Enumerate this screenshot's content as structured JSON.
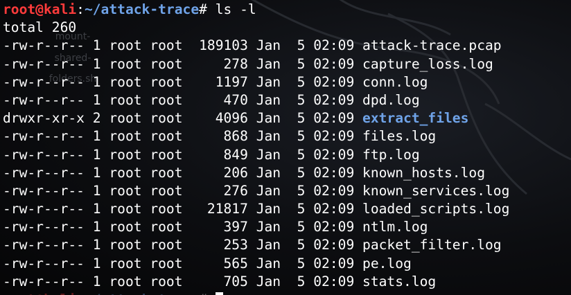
{
  "prompt": {
    "user_host": "root@kali",
    "separator": ":",
    "path": "~/attack-trace",
    "symbol": "# ",
    "command": "ls -l"
  },
  "total_line": "total 260",
  "listing": [
    {
      "perms": "-rw-r--r--",
      "links": "1",
      "owner": "root",
      "group": "root",
      "size": "189103",
      "month": "Jan",
      "day": "5",
      "time": "02:09",
      "name": "attack-trace.pcap",
      "type": "file"
    },
    {
      "perms": "-rw-r--r--",
      "links": "1",
      "owner": "root",
      "group": "root",
      "size": "278",
      "month": "Jan",
      "day": "5",
      "time": "02:09",
      "name": "capture_loss.log",
      "type": "file"
    },
    {
      "perms": "-rw-r--r--",
      "links": "1",
      "owner": "root",
      "group": "root",
      "size": "1197",
      "month": "Jan",
      "day": "5",
      "time": "02:09",
      "name": "conn.log",
      "type": "file"
    },
    {
      "perms": "-rw-r--r--",
      "links": "1",
      "owner": "root",
      "group": "root",
      "size": "470",
      "month": "Jan",
      "day": "5",
      "time": "02:09",
      "name": "dpd.log",
      "type": "file"
    },
    {
      "perms": "drwxr-xr-x",
      "links": "2",
      "owner": "root",
      "group": "root",
      "size": "4096",
      "month": "Jan",
      "day": "5",
      "time": "02:09",
      "name": "extract_files",
      "type": "dir"
    },
    {
      "perms": "-rw-r--r--",
      "links": "1",
      "owner": "root",
      "group": "root",
      "size": "868",
      "month": "Jan",
      "day": "5",
      "time": "02:09",
      "name": "files.log",
      "type": "file"
    },
    {
      "perms": "-rw-r--r--",
      "links": "1",
      "owner": "root",
      "group": "root",
      "size": "849",
      "month": "Jan",
      "day": "5",
      "time": "02:09",
      "name": "ftp.log",
      "type": "file"
    },
    {
      "perms": "-rw-r--r--",
      "links": "1",
      "owner": "root",
      "group": "root",
      "size": "206",
      "month": "Jan",
      "day": "5",
      "time": "02:09",
      "name": "known_hosts.log",
      "type": "file"
    },
    {
      "perms": "-rw-r--r--",
      "links": "1",
      "owner": "root",
      "group": "root",
      "size": "276",
      "month": "Jan",
      "day": "5",
      "time": "02:09",
      "name": "known_services.log",
      "type": "file"
    },
    {
      "perms": "-rw-r--r--",
      "links": "1",
      "owner": "root",
      "group": "root",
      "size": "21817",
      "month": "Jan",
      "day": "5",
      "time": "02:09",
      "name": "loaded_scripts.log",
      "type": "file"
    },
    {
      "perms": "-rw-r--r--",
      "links": "1",
      "owner": "root",
      "group": "root",
      "size": "397",
      "month": "Jan",
      "day": "5",
      "time": "02:09",
      "name": "ntlm.log",
      "type": "file"
    },
    {
      "perms": "-rw-r--r--",
      "links": "1",
      "owner": "root",
      "group": "root",
      "size": "253",
      "month": "Jan",
      "day": "5",
      "time": "02:09",
      "name": "packet_filter.log",
      "type": "file"
    },
    {
      "perms": "-rw-r--r--",
      "links": "1",
      "owner": "root",
      "group": "root",
      "size": "565",
      "month": "Jan",
      "day": "5",
      "time": "02:09",
      "name": "pe.log",
      "type": "file"
    },
    {
      "perms": "-rw-r--r--",
      "links": "1",
      "owner": "root",
      "group": "root",
      "size": "705",
      "month": "Jan",
      "day": "5",
      "time": "02:09",
      "name": "stats.log",
      "type": "file"
    }
  ],
  "desktop_ghost_labels": [
    "mount-",
    "shared-",
    "folders.sh"
  ],
  "colors": {
    "user_host": "#ff3b3b",
    "path": "#6fa3e8",
    "directory": "#6fa3e8",
    "text": "#ffffff",
    "background": "#0c0d10"
  },
  "icons": {
    "background_art": "kali-dragon-icon",
    "cursor": "block-cursor-icon"
  }
}
